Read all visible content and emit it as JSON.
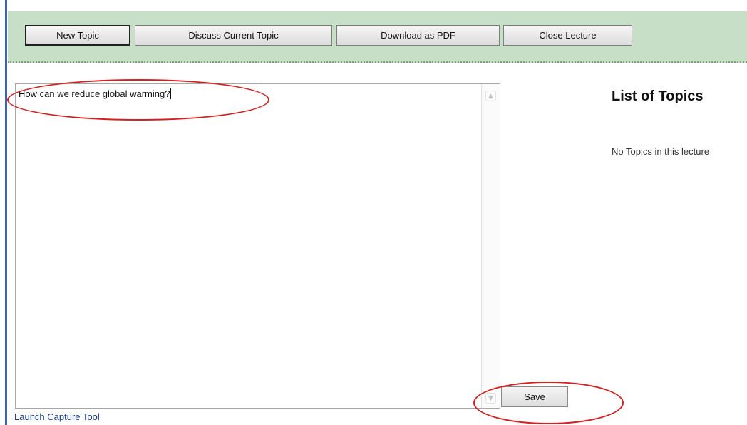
{
  "toolbar": {
    "buttons": [
      {
        "label": "New Topic",
        "active": true
      },
      {
        "label": "Discuss Current Topic",
        "active": false
      },
      {
        "label": "Download as PDF",
        "active": false
      },
      {
        "label": "Close Lecture",
        "active": false
      }
    ]
  },
  "editor": {
    "value": "How can we reduce global warming?"
  },
  "save_label": "Save",
  "capture_link": "Launch Capture Tool",
  "topics": {
    "title": "List of Topics",
    "empty_message": "No Topics in this lecture"
  },
  "colors": {
    "toolbar_background": "#c8dfc7",
    "highlight_marker": "#d42020",
    "link": "#1a3a8a"
  },
  "icons": {
    "scroll_up": "chevron-up-icon",
    "scroll_down": "chevron-down-icon"
  }
}
